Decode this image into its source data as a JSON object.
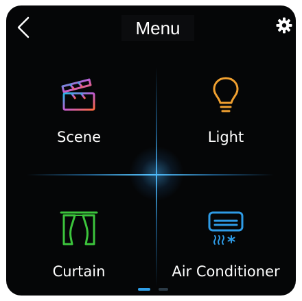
{
  "header": {
    "title": "Menu"
  },
  "icons": {
    "back": "chevron-left-icon",
    "settings": "gear-icon"
  },
  "tiles": [
    {
      "label": "Scene",
      "icon": "clapperboard-icon"
    },
    {
      "label": "Light",
      "icon": "lightbulb-icon"
    },
    {
      "label": "Curtain",
      "icon": "curtain-icon"
    },
    {
      "label": "Air Conditioner",
      "icon": "air-conditioner-icon"
    }
  ],
  "pagination": {
    "pages": 2,
    "current": 1
  },
  "colors": {
    "background": "#050607",
    "accent": "#2f9fe8",
    "curtain_green": "#3cc43c",
    "bulb_orange": "#f0a030",
    "ac_blue": "#2e9be6"
  }
}
